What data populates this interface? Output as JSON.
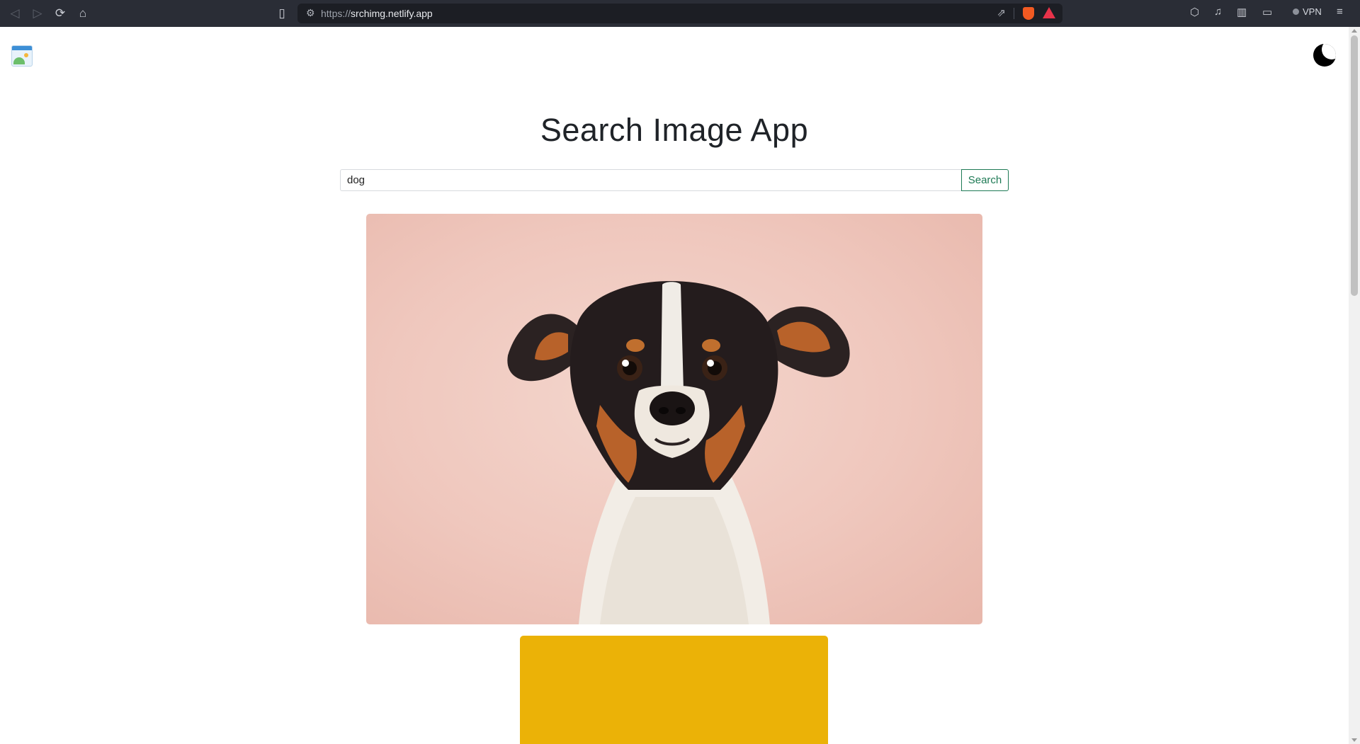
{
  "browser": {
    "url_scheme": "https://",
    "url_host": "srchimg.netlify.app",
    "vpn_label": "VPN",
    "icons": [
      "back-icon",
      "forward-icon",
      "reload-icon",
      "home-icon",
      "bookmark-icon",
      "site-settings-icon",
      "share-icon",
      "brave-shields-icon",
      "brave-rewards-icon",
      "extensions-icon",
      "media-icon",
      "sidebar-icon",
      "wallet-icon",
      "menu-icon"
    ]
  },
  "header": {
    "logo_icon": "image-search-logo-icon",
    "theme_toggle_icon": "moon-icon"
  },
  "main": {
    "title": "Search Image App",
    "search": {
      "value": "dog",
      "button_label": "Search"
    },
    "results": [
      {
        "kind": "photo",
        "subject": "dog-icon",
        "background": "#efc7bd"
      },
      {
        "kind": "photo",
        "background": "#ebb207"
      }
    ]
  }
}
